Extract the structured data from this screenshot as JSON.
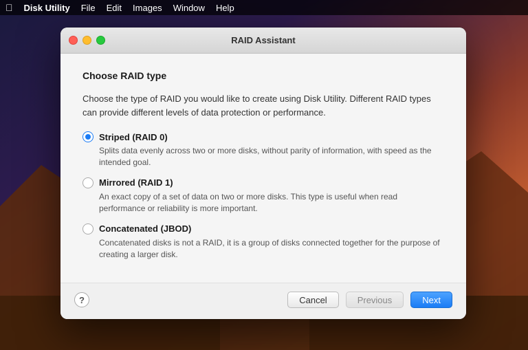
{
  "menubar": {
    "apple": "⌘",
    "app": "Disk Utility",
    "menus": [
      "File",
      "Edit",
      "Images",
      "Window",
      "Help"
    ]
  },
  "titlebar": {
    "title": "RAID Assistant"
  },
  "dialog": {
    "section_title": "Choose RAID type",
    "description": "Choose the type of RAID you would like to create using Disk Utility. Different RAID types can provide different levels of data protection or performance.",
    "options": [
      {
        "id": "striped",
        "title": "Striped (RAID 0)",
        "description": "Splits data evenly across two or more disks, without parity of information, with speed as the intended goal.",
        "selected": true
      },
      {
        "id": "mirrored",
        "title": "Mirrored (RAID 1)",
        "description": "An exact copy of a set of data on two or more disks. This type is useful when read performance or reliability is more important.",
        "selected": false
      },
      {
        "id": "concatenated",
        "title": "Concatenated (JBOD)",
        "description": "Concatenated disks is not a RAID, it is a group of disks connected together for the purpose of creating a larger disk.",
        "selected": false
      }
    ]
  },
  "buttons": {
    "help": "?",
    "cancel": "Cancel",
    "previous": "Previous",
    "next": "Next"
  },
  "colors": {
    "accent": "#1b7cf5",
    "radio_selected": "#1b7cf5"
  }
}
